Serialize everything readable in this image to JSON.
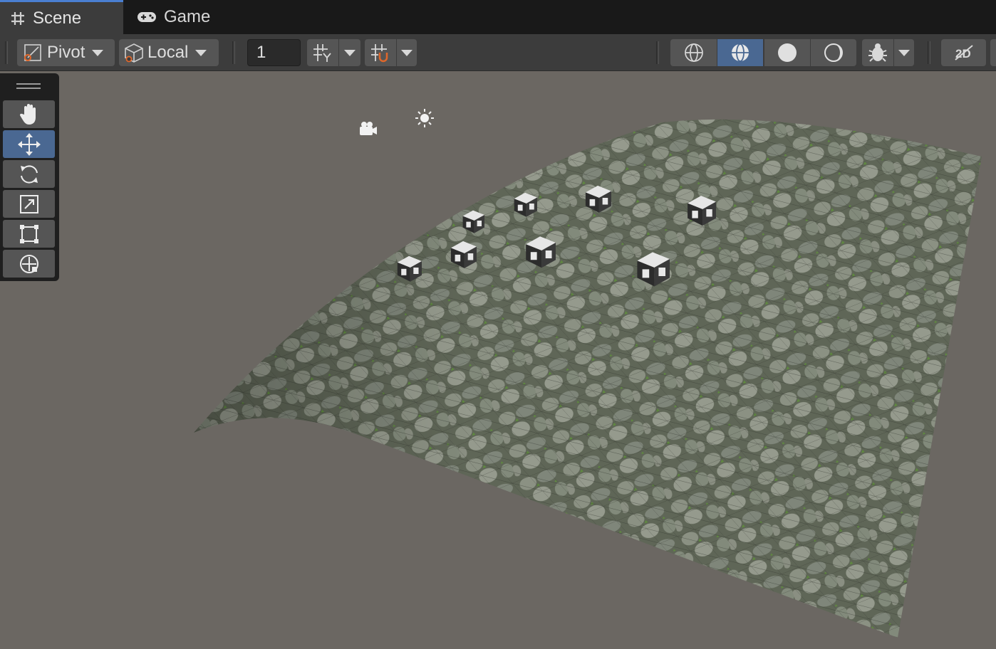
{
  "tabs": [
    {
      "label": "Scene",
      "icon": "hash-icon",
      "active": true
    },
    {
      "label": "Game",
      "icon": "gamepad-icon",
      "active": false
    }
  ],
  "toolbar": {
    "pivot_label": "Pivot",
    "local_label": "Local",
    "grid_snap_value": "1",
    "draw_modes": [
      "wireframe",
      "shaded-wireframe",
      "shaded",
      "unlit"
    ],
    "selected_draw_mode": "shaded-wireframe"
  },
  "tools": [
    {
      "name": "view-tool",
      "icon": "hand-icon"
    },
    {
      "name": "move-tool",
      "icon": "move-arrows-icon",
      "selected": true
    },
    {
      "name": "rotate-tool",
      "icon": "rotate-icon"
    },
    {
      "name": "scale-tool",
      "icon": "scale-icon"
    },
    {
      "name": "rect-tool",
      "icon": "rect-transform-icon"
    },
    {
      "name": "transform-tool",
      "icon": "transform-icon"
    }
  ],
  "colors": {
    "accent": "#4a7fd1",
    "selected": "#4a6892",
    "viewport_bg": "#6b6762",
    "toolbar_bg": "#3c3c3c"
  }
}
